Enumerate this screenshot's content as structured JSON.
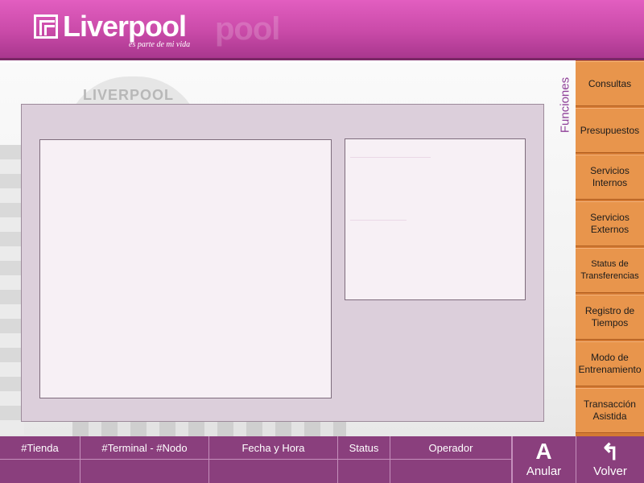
{
  "header": {
    "brand": "Liverpool",
    "tagline": "es parte de mi vida",
    "ghost_brand": "pool",
    "background_sign": "LIVERPOOL"
  },
  "sidebar": {
    "title": "Funciones",
    "items": [
      {
        "label": "Consultas"
      },
      {
        "label": "Presupuestos"
      },
      {
        "label": "Servicios Internos"
      },
      {
        "label": "Servicios Externos"
      },
      {
        "label": "Status de Transferencias"
      },
      {
        "label": "Registro de Tiempos"
      },
      {
        "label": "Modo de Entrenamiento"
      },
      {
        "label": "Transacción Asistida"
      }
    ]
  },
  "footer": {
    "columns": [
      {
        "label": "#Tienda",
        "value": ""
      },
      {
        "label": "#Terminal - #Nodo",
        "value": ""
      },
      {
        "label": "Fecha y Hora",
        "value": ""
      },
      {
        "label": "Status",
        "value": ""
      },
      {
        "label": "Operador",
        "value": ""
      }
    ],
    "anular_label": "Anular",
    "anular_icon": "A",
    "volver_label": "Volver",
    "volver_icon": "↰"
  },
  "colors": {
    "header": "#c94aa8",
    "menu": "#e8954c",
    "footer": "#8a3f7d",
    "panel": "#dccfdb",
    "accent_text": "#8e3f98"
  }
}
